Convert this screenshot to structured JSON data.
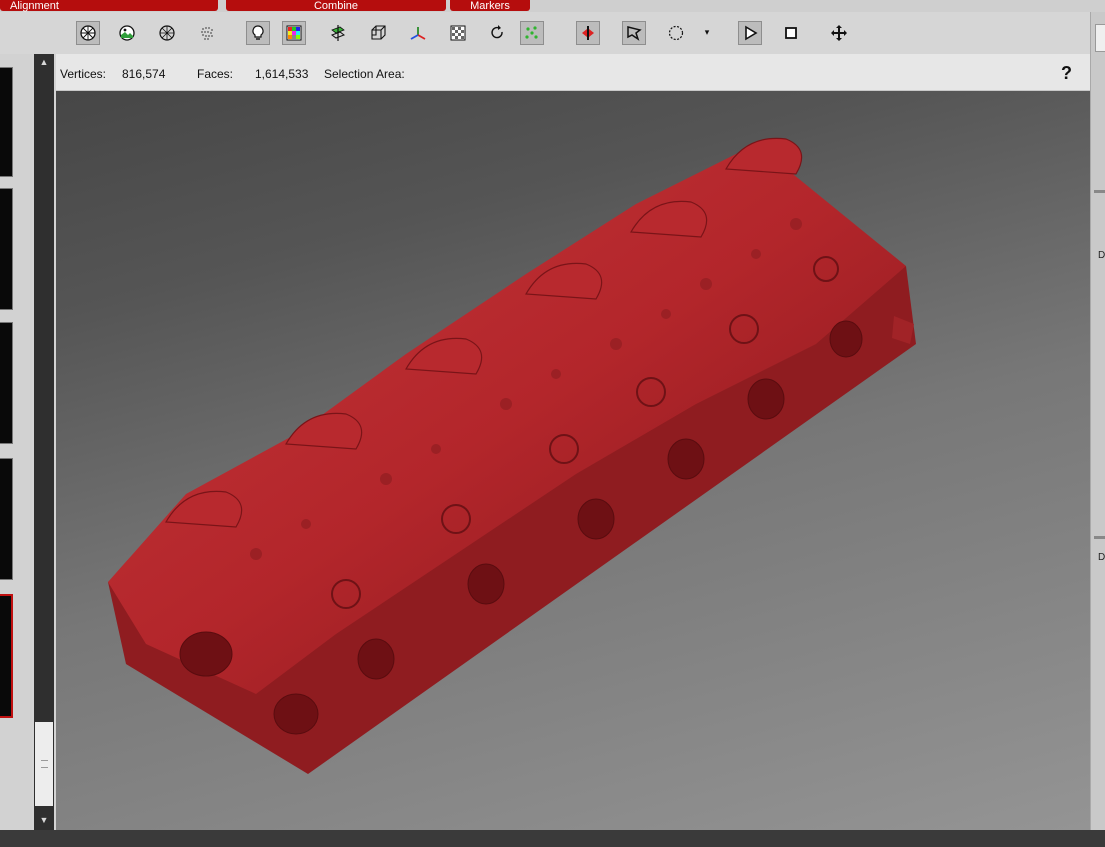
{
  "tabs": [
    {
      "label": "Alignment"
    },
    {
      "label": "Combine"
    },
    {
      "label": "Markers"
    }
  ],
  "toolbar": {
    "tools": [
      {
        "icon": "shaded-sphere-icon"
      },
      {
        "icon": "textured-sphere-icon"
      },
      {
        "icon": "wireframe-sphere-icon"
      },
      {
        "icon": "point-cloud-icon"
      },
      {
        "icon": "light-bulb-icon"
      },
      {
        "icon": "color-grid-icon"
      },
      {
        "icon": "clip-plane-icon"
      },
      {
        "icon": "bounding-box-icon"
      },
      {
        "icon": "axis-triad-icon"
      },
      {
        "icon": "checker-icon"
      },
      {
        "icon": "rotate-icon"
      },
      {
        "icon": "points-select-icon"
      },
      {
        "icon": "flip-normals-icon"
      },
      {
        "icon": "lasso-select-icon"
      },
      {
        "icon": "circle-select-icon"
      },
      {
        "icon": "dropdown-arrow-icon"
      },
      {
        "icon": "play-icon"
      },
      {
        "icon": "square-select-icon"
      },
      {
        "icon": "move-icon"
      }
    ]
  },
  "status": {
    "vertices_label": "Vertices:",
    "vertices_value": "816,574",
    "faces_label": "Faces:",
    "faces_value": "1,614,533",
    "selection_label": "Selection Area:",
    "help": "?"
  },
  "right_panel": {
    "label_1": "D",
    "label_2": "D"
  },
  "colors": {
    "model_red": "#b3262b",
    "tab_red": "#b50d0d",
    "accent_green": "#2fb42f"
  }
}
